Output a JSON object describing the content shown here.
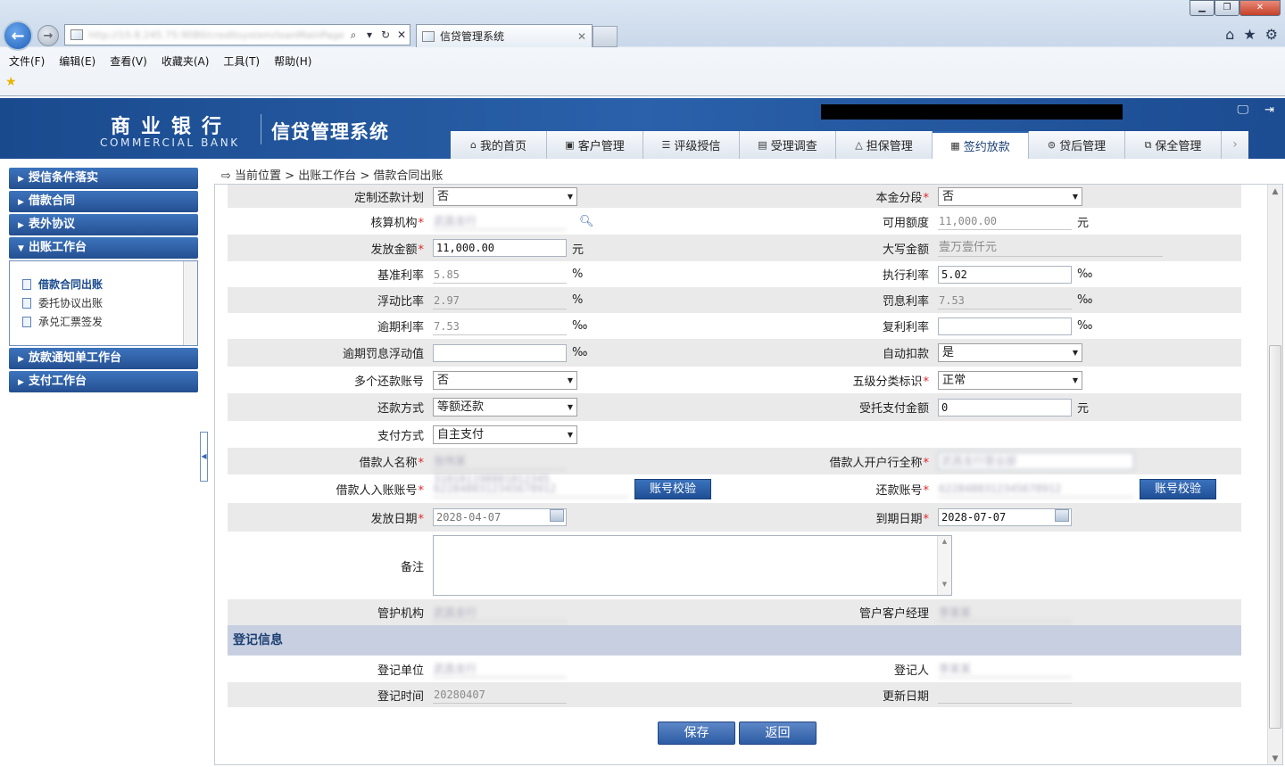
{
  "browser": {
    "url": "http://10.8.245.75:9080/creditsystem/loanMainPage.do",
    "tab_title": "信贷管理系统",
    "menu": [
      "文件(F)",
      "编辑(E)",
      "查看(V)",
      "收藏夹(A)",
      "工具(T)",
      "帮助(H)"
    ]
  },
  "header": {
    "logo_zh": "商业银行",
    "logo_en": "COMMERCIAL BANK",
    "system_title": "信贷管理系统"
  },
  "nav_tabs": [
    {
      "label": "我的首页",
      "icon": "home-icon"
    },
    {
      "label": "客户管理",
      "icon": "customer-icon"
    },
    {
      "label": "评级授信",
      "icon": "rating-icon"
    },
    {
      "label": "受理调查",
      "icon": "survey-icon"
    },
    {
      "label": "担保管理",
      "icon": "guarantee-icon"
    },
    {
      "label": "签约放款",
      "icon": "contract-icon",
      "active": true
    },
    {
      "label": "贷后管理",
      "icon": "postloan-icon"
    },
    {
      "label": "保全管理",
      "icon": "preservation-icon"
    }
  ],
  "sidebar": {
    "sections": [
      "授信条件落实",
      "借款合同",
      "表外协议",
      "出账工作台",
      "放款通知单工作台",
      "支付工作台"
    ],
    "sub_items": [
      "借款合同出账",
      "委托协议出账",
      "承兑汇票签发"
    ]
  },
  "breadcrumb": "当前位置 > 出账工作台 > 借款合同出账",
  "form": {
    "custom_plan": {
      "label": "定制还款计划",
      "value": "否"
    },
    "principal_split": {
      "label": "本金分段",
      "value": "否"
    },
    "accounting_org": {
      "label": "核算机构",
      "value": "武昌支行"
    },
    "available_amount": {
      "label": "可用额度",
      "value": "11,000.00",
      "unit": "元"
    },
    "disburse_amount": {
      "label": "发放金额",
      "value": "11,000.00",
      "unit": "元"
    },
    "amount_upper": {
      "label": "大写金额",
      "value": "壹万壹仟元"
    },
    "base_rate": {
      "label": "基准利率",
      "value": "5.85",
      "unit": "%"
    },
    "exec_rate": {
      "label": "执行利率",
      "value": "5.02",
      "unit": "‰"
    },
    "float_ratio": {
      "label": "浮动比率",
      "value": "2.97",
      "unit": "%"
    },
    "penalty_rate": {
      "label": "罚息利率",
      "value": "7.53",
      "unit": "‰"
    },
    "overdue_rate": {
      "label": "逾期利率",
      "value": "7.53",
      "unit": "‰"
    },
    "compound_rate": {
      "label": "复利利率",
      "value": "",
      "unit": "‰"
    },
    "overdue_float": {
      "label": "逾期罚息浮动值",
      "value": "",
      "unit": "‰"
    },
    "auto_deduct": {
      "label": "自动扣款",
      "value": "是"
    },
    "multi_account": {
      "label": "多个还款账号",
      "value": "否"
    },
    "five_class": {
      "label": "五级分类标识",
      "value": "正常"
    },
    "repay_method": {
      "label": "还款方式",
      "value": "等额还款"
    },
    "entrusted_pay": {
      "label": "受托支付金额",
      "value": "0",
      "unit": "元"
    },
    "pay_method": {
      "label": "支付方式",
      "value": "自主支付"
    },
    "borrower_name": {
      "label": "借款人名称",
      "value": "张伟某 310101198801012345"
    },
    "borrower_bank": {
      "label": "借款人开户行全称",
      "value": "武昌支行营业部"
    },
    "borrower_account": {
      "label": "借款人入账账号",
      "value": "6228480312345678912",
      "button": "账号校验"
    },
    "repay_account": {
      "label": "还款账号",
      "value": "6228480312345678912",
      "button": "账号校验"
    },
    "issue_date": {
      "label": "发放日期",
      "value": "2028-04-07"
    },
    "due_date": {
      "label": "到期日期",
      "value": "2028-07-07"
    },
    "remark": {
      "label": "备注",
      "value": ""
    },
    "custody_org": {
      "label": "管护机构",
      "value": "武昌支行"
    },
    "custody_manager": {
      "label": "管户客户经理",
      "value": "李某某"
    }
  },
  "registration": {
    "title": "登记信息",
    "reg_unit": {
      "label": "登记单位",
      "value": "武昌支行"
    },
    "registrar": {
      "label": "登记人",
      "value": "李某某"
    },
    "reg_time": {
      "label": "登记时间",
      "value": "20280407"
    },
    "update_date": {
      "label": "更新日期",
      "value": ""
    }
  },
  "buttons": {
    "save": "保存",
    "back": "返回"
  }
}
